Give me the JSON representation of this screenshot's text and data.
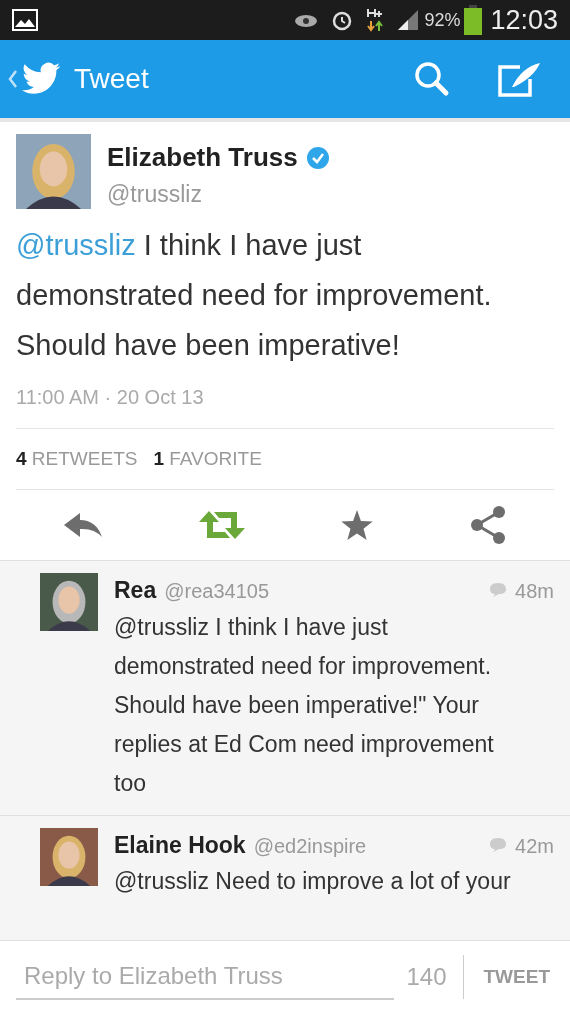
{
  "status_bar": {
    "battery": "92%",
    "time": "12:03"
  },
  "header": {
    "title": "Tweet"
  },
  "tweet": {
    "name": "Elizabeth Truss",
    "verified": true,
    "handle": "@trussliz",
    "mention": "@trussliz",
    "text": "I think I have just demonstrated need for improvement. Should have been imperative!",
    "timestamp": "11:00 AM · 20 Oct 13",
    "stats": [
      {
        "count": "4",
        "label": "RETWEETS"
      },
      {
        "count": "1",
        "label": "FAVORITE"
      }
    ],
    "retweeted": true,
    "favorited": false
  },
  "replies": [
    {
      "name": "Rea",
      "handle": "@rea34105",
      "time": "48m",
      "text": "@trussliz I think I have just demonstrated need for improvement. Should have been imperative!\" Your replies at Ed Com need improvement too"
    },
    {
      "name": "Elaine Hook",
      "handle": "@ed2inspire",
      "time": "42m",
      "text": "@trussliz Need to improve a lot of your"
    }
  ],
  "reply_bar": {
    "placeholder": "Reply to Elizabeth Truss",
    "count": "140",
    "button": "TWEET"
  }
}
